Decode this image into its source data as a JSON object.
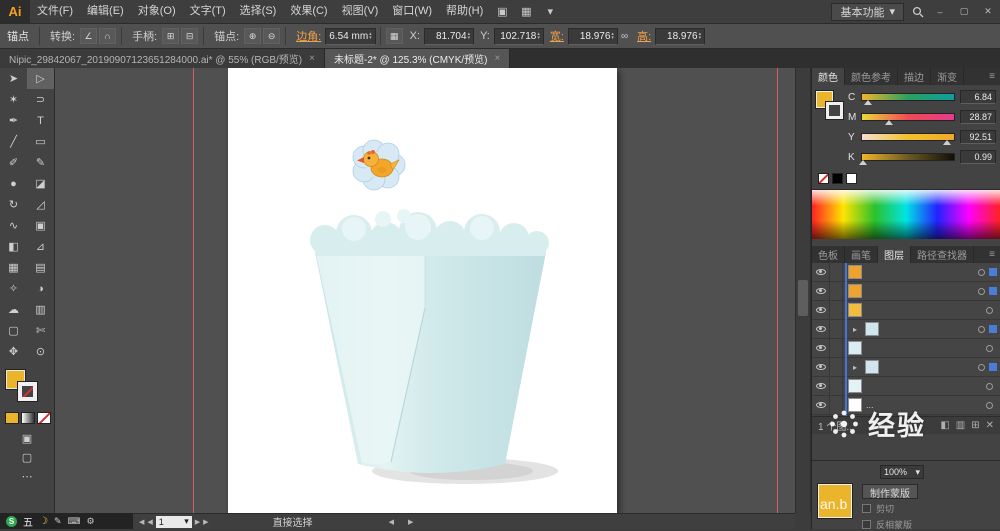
{
  "glyphs": {
    "caret_down": "▾",
    "close_x": "×",
    "minimize": "–",
    "maximize": "▢",
    "close": "✕",
    "panel_menu": "≡",
    "prev": "◀",
    "next": "▶",
    "grid": "▦",
    "link": "∞",
    "arrange": "▣",
    "layout": "▦",
    "moon": "☽",
    "pencil": "✎",
    "keyboard": "⌨",
    "gear": "⚙",
    "stepper_up": "▴",
    "stepper_down": "▾",
    "swap": "⇄",
    "drawing_mode": "▣",
    "screen_mode": "▢",
    "dots": "⋯"
  },
  "menu_bar": {
    "logo": "Ai",
    "items": [
      "文件(F)",
      "编辑(E)",
      "对象(O)",
      "文字(T)",
      "选择(S)",
      "效果(C)",
      "视图(V)",
      "窗口(W)",
      "帮助(H)"
    ],
    "workspace": "基本功能"
  },
  "control_bar": {
    "context_label": "锚点",
    "convert_label": "转换:",
    "convert_icons": [
      "∠",
      "∩"
    ],
    "handles_label": "手柄:",
    "handles_icons": [
      "⊞",
      "⊟"
    ],
    "anchors_label": "锚点:",
    "anchors_icons": [
      "⊕",
      "⊖"
    ],
    "corner_label": "边角:",
    "corner_value": "6.54 mm",
    "x_label": "X:",
    "x_value": "81.704",
    "y_label": "Y:",
    "y_value": "102.718",
    "w_label": "宽:",
    "w_value": "18.976",
    "h_label": "高:",
    "h_value": "18.976"
  },
  "doc_tabs": [
    {
      "label": "Nipic_29842067_20190907123651284000.ai* @ 55% (RGB/预览)"
    },
    {
      "label": "未标题-2* @ 125.3% (CMYK/预览)"
    }
  ],
  "toolbar": {
    "tools": [
      {
        "glyph": "➤",
        "name": "selection-tool"
      },
      {
        "glyph": "▷",
        "name": "direct-selection-tool",
        "bg": "#616161"
      },
      {
        "glyph": "✶",
        "name": "magic-wand-tool"
      },
      {
        "glyph": "⊃",
        "name": "lasso-tool"
      },
      {
        "glyph": "✒",
        "name": "pen-tool"
      },
      {
        "glyph": "T",
        "name": "type-tool"
      },
      {
        "glyph": "╱",
        "name": "line-segment-tool"
      },
      {
        "glyph": "▭",
        "name": "rectangle-tool"
      },
      {
        "glyph": "✐",
        "name": "paintbrush-tool"
      },
      {
        "glyph": "✎",
        "name": "pencil-tool"
      },
      {
        "glyph": "●",
        "name": "blob-brush-tool"
      },
      {
        "glyph": "◪",
        "name": "eraser-tool"
      },
      {
        "glyph": "↻",
        "name": "rotate-tool"
      },
      {
        "glyph": "◿",
        "name": "scale-tool"
      },
      {
        "glyph": "∿",
        "name": "width-tool"
      },
      {
        "glyph": "▣",
        "name": "free-transform-tool"
      },
      {
        "glyph": "◧",
        "name": "shape-builder-tool"
      },
      {
        "glyph": "⊿",
        "name": "perspective-grid-tool"
      },
      {
        "glyph": "▦",
        "name": "mesh-tool"
      },
      {
        "glyph": "▤",
        "name": "gradient-tool"
      },
      {
        "glyph": "✧",
        "name": "eyedropper-tool"
      },
      {
        "glyph": "◑",
        "name": "blend-tool"
      },
      {
        "glyph": "☁",
        "name": "symbol-sprayer-tool"
      },
      {
        "glyph": "▥",
        "name": "column-graph-tool"
      },
      {
        "glyph": "▢",
        "name": "artboard-tool"
      },
      {
        "glyph": "✄",
        "name": "slice-tool"
      },
      {
        "glyph": "✥",
        "name": "hand-tool"
      },
      {
        "glyph": "⊙",
        "name": "zoom-tool"
      }
    ],
    "fill_color": "#eab52a"
  },
  "color_panel": {
    "tabs": [
      "颜色",
      "颜色参考",
      "描边",
      "渐变"
    ],
    "sliders": [
      {
        "label": "C",
        "value": "6.84",
        "pos": "6.84%",
        "track": "linear-gradient(to right,#f0b42c,#2ba05e,#0e9e9e)"
      },
      {
        "label": "M",
        "value": "28.87",
        "pos": "28.87%",
        "track": "linear-gradient(to right,#ead83a,#ee4b53,#e83a8c)"
      },
      {
        "label": "Y",
        "value": "92.51",
        "pos": "92.51%",
        "track": "linear-gradient(to right,#f6dcd4,#f2c22c,#f0a82a)"
      },
      {
        "label": "K",
        "value": "0.99",
        "pos": "1%",
        "track": "linear-gradient(to right,#f2b42c,#6b5a22,#111008)"
      }
    ],
    "fill_color": "#eab52a"
  },
  "panels_mid": {
    "tabs": [
      "色板",
      "画笔",
      "图层",
      "路径查找器"
    ]
  },
  "layers_panel": {
    "rows": [
      {
        "thumb": "#efa32f",
        "sel": true
      },
      {
        "thumb": "#efa32f",
        "sel": true
      },
      {
        "thumb": "#f2bc40"
      },
      {
        "thumb": "#cfe6ee",
        "expand": "▸",
        "sel": true
      },
      {
        "thumb": "#d9edf3"
      },
      {
        "thumb": "#cfe6ee",
        "expand": "▸",
        "sel": true
      },
      {
        "thumb": "#e4f2f5"
      },
      {
        "thumb": "#ffffff",
        "label": "..."
      }
    ],
    "status_text": "1 个图...",
    "bottom_icons": [
      "◧",
      "▥",
      "⊞",
      "✕"
    ]
  },
  "transparency": {
    "opacity_value": "100%",
    "make_mask_button": "制作蒙版",
    "clip_label": "剪切",
    "invert_label": "反相蒙版",
    "thumb_color": "#eab52a"
  },
  "status_bar": {
    "artboard_number": "1",
    "tool_name": "直接选择"
  },
  "ime": {
    "brand": "S",
    "mode": "五"
  },
  "watermark": {
    "main": "经验",
    "partial": "an.b"
  }
}
